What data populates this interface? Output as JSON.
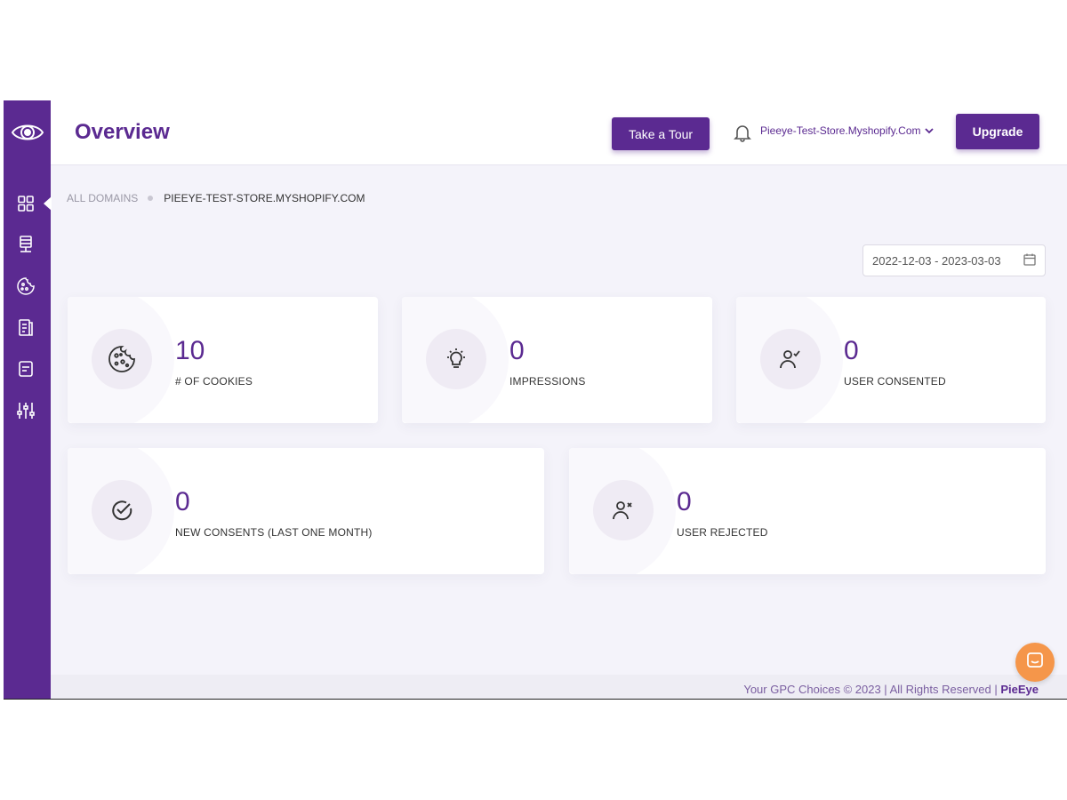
{
  "header": {
    "title": "Overview",
    "tour_label": "Take a Tour",
    "store_label": "Pieeye-Test-Store.Myshopify.Com",
    "upgrade_label": "Upgrade"
  },
  "sidebar": {
    "items": [
      {
        "name": "dashboard",
        "icon": "grid-icon",
        "active": true
      },
      {
        "name": "sites",
        "icon": "server-icon"
      },
      {
        "name": "cookies",
        "icon": "cookie-icon"
      },
      {
        "name": "policies",
        "icon": "document-icon"
      },
      {
        "name": "forms",
        "icon": "note-icon"
      },
      {
        "name": "settings",
        "icon": "sliders-icon"
      }
    ]
  },
  "breadcrumb": {
    "all": "ALL DOMAINS",
    "current": "PIEEYE-TEST-STORE.MYSHOPIFY.COM"
  },
  "date_range": "2022-12-03 - 2023-03-03",
  "stats": [
    {
      "value": "10",
      "label": "# OF COOKIES",
      "icon": "cookie-icon"
    },
    {
      "value": "0",
      "label": "IMPRESSIONS",
      "icon": "lightbulb-icon"
    },
    {
      "value": "0",
      "label": "USER CONSENTED",
      "icon": "user-check-icon"
    },
    {
      "value": "0",
      "label": "NEW CONSENTS (LAST ONE MONTH)",
      "icon": "check-circle-icon"
    },
    {
      "value": "0",
      "label": "USER REJECTED",
      "icon": "user-x-icon"
    }
  ],
  "footer": {
    "text": "Your GPC Choices © 2023 | All Rights Reserved | ",
    "brand": "PieEye"
  },
  "colors": {
    "primary": "#5b2a91",
    "chat": "#f5964a"
  }
}
